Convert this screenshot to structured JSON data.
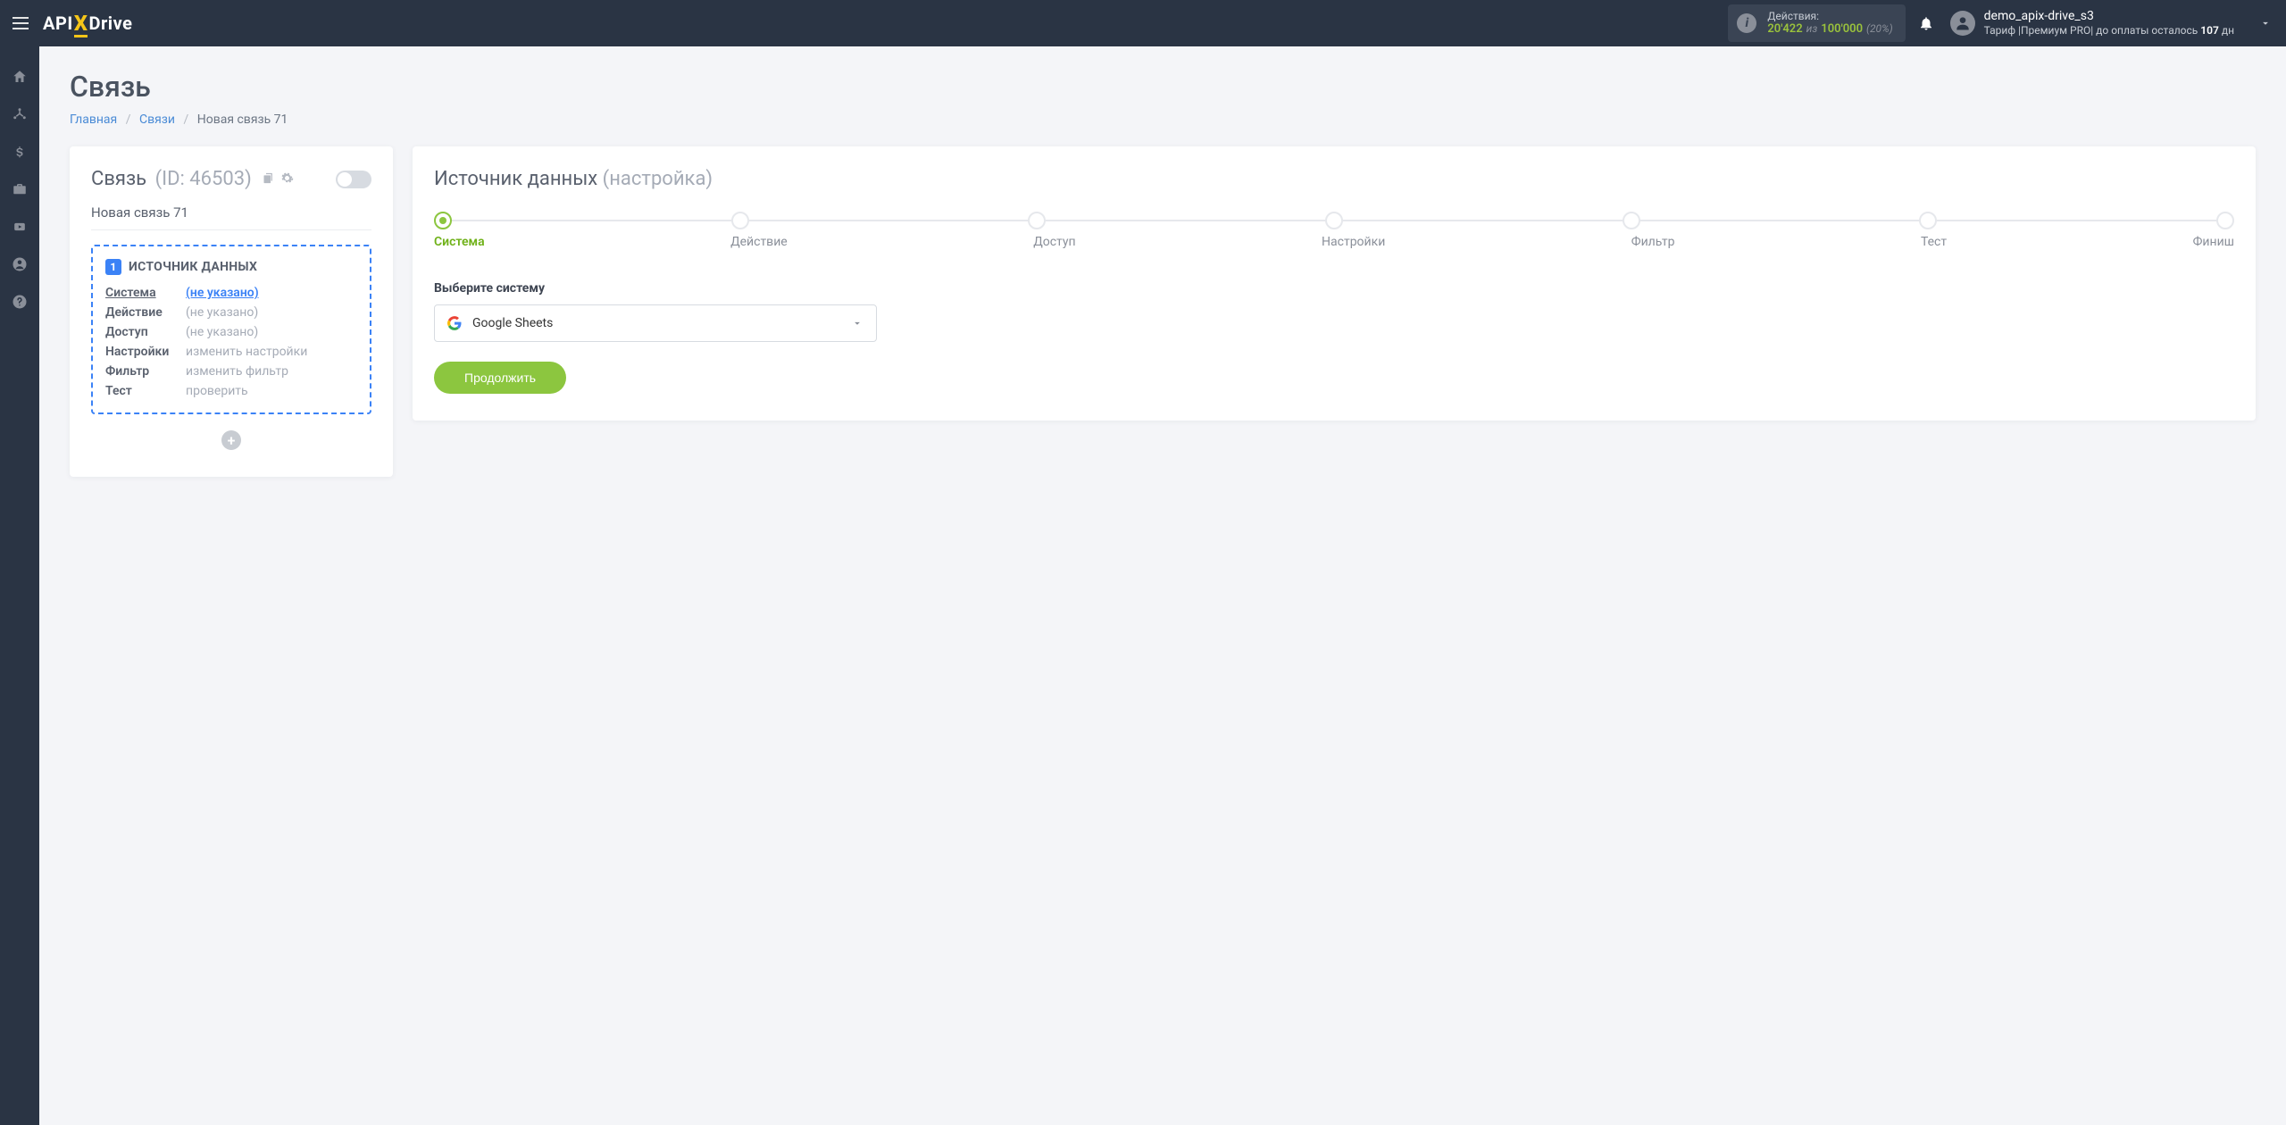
{
  "brand": {
    "api": "API",
    "x": "X",
    "drive": "Drive"
  },
  "topbar": {
    "actions_label": "Действия:",
    "actions_used": "20'422",
    "actions_of": "из",
    "actions_total": "100'000",
    "actions_pct": "(20%)",
    "user_name": "demo_apix-drive_s3",
    "tariff_prefix": "Тариф |Премиум PRO| до оплаты осталось ",
    "tariff_days": "107",
    "tariff_suffix": " дн"
  },
  "page": {
    "title": "Связь",
    "breadcrumb": {
      "home": "Главная",
      "links": "Связи",
      "current": "Новая связь 71"
    }
  },
  "left_card": {
    "title": "Связь",
    "id_label": "(ID: 46503)",
    "name": "Новая связь 71",
    "block_number": "1",
    "block_title": "ИСТОЧНИК ДАННЫХ",
    "rows": {
      "system": {
        "label": "Система",
        "value": "(не указано)"
      },
      "action": {
        "label": "Действие",
        "value": "(не указано)"
      },
      "access": {
        "label": "Доступ",
        "value": "(не указано)"
      },
      "settings": {
        "label": "Настройки",
        "value": "изменить настройки"
      },
      "filter": {
        "label": "Фильтр",
        "value": "изменить фильтр"
      },
      "test": {
        "label": "Тест",
        "value": "проверить"
      }
    }
  },
  "right_card": {
    "title": "Источник данных",
    "title_suffix": "(настройка)",
    "steps": [
      "Система",
      "Действие",
      "Доступ",
      "Настройки",
      "Фильтр",
      "Тест",
      "Финиш"
    ],
    "select_label": "Выберите систему",
    "select_value": "Google Sheets",
    "continue": "Продолжить"
  }
}
